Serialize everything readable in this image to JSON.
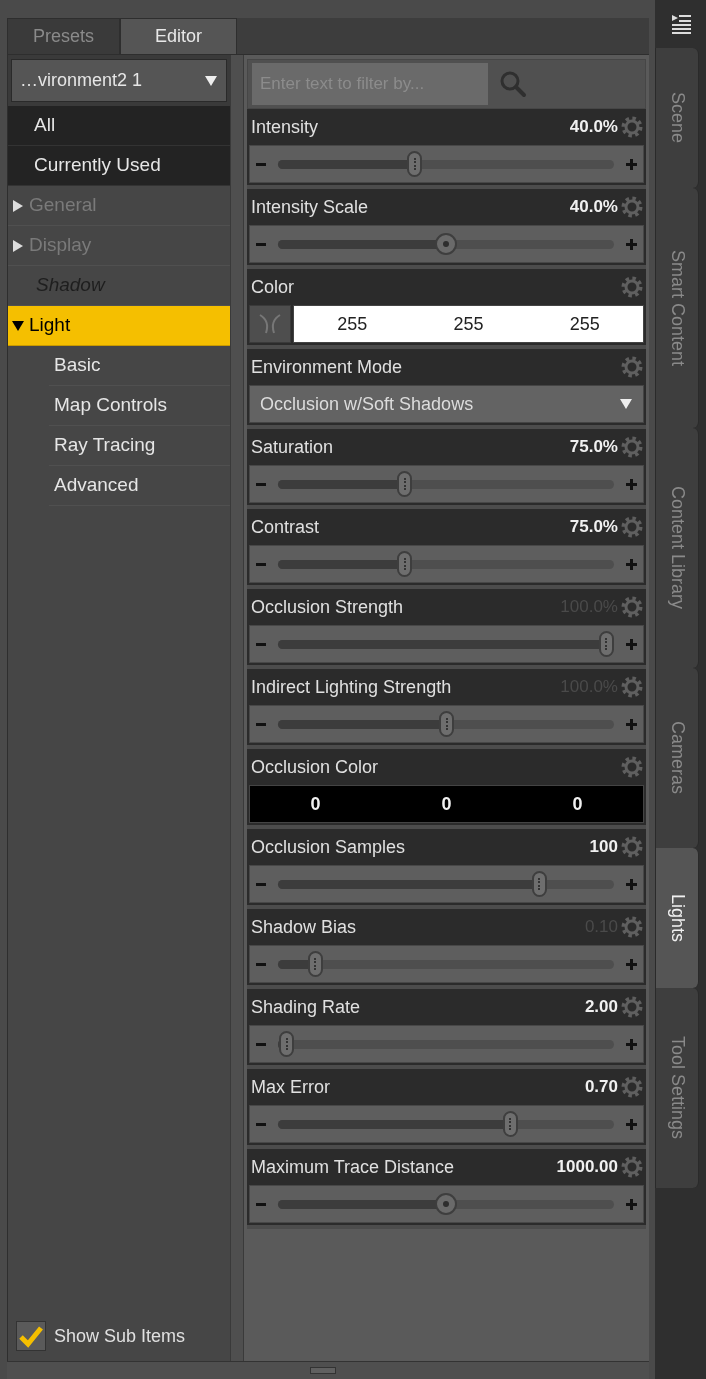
{
  "tabs": [
    {
      "label": "Presets",
      "selected": false
    },
    {
      "label": "Editor",
      "selected": true
    }
  ],
  "node_dropdown": {
    "value": "…vironment2 1"
  },
  "categories": [
    {
      "label": "All",
      "kind": "filter",
      "selected": false
    },
    {
      "label": "Currently Used",
      "kind": "filter",
      "selected": false
    },
    {
      "label": "General",
      "kind": "group",
      "expanded": false,
      "disabled": true,
      "selected": false
    },
    {
      "label": "Display",
      "kind": "group",
      "expanded": false,
      "disabled": true,
      "selected": false
    },
    {
      "label": "Shadow",
      "kind": "empty",
      "selected": false
    },
    {
      "label": "Light",
      "kind": "group",
      "expanded": true,
      "disabled": false,
      "selected": true,
      "children": [
        {
          "label": "Basic",
          "selected": false
        },
        {
          "label": "Map Controls",
          "selected": false
        },
        {
          "label": "Ray Tracing",
          "selected": false
        },
        {
          "label": "Advanced",
          "selected": false
        }
      ]
    }
  ],
  "show_sub_items": {
    "label": "Show Sub Items",
    "checked": true
  },
  "filter": {
    "placeholder": "Enter text to filter by..."
  },
  "parameters": [
    {
      "kind": "slider",
      "label": "Intensity",
      "value": "40.0%",
      "dimmed": false,
      "level": 0.4
    },
    {
      "kind": "dial_slider",
      "label": "Intensity Scale",
      "value": "40.0%",
      "dimmed": false,
      "level": 0.5
    },
    {
      "kind": "color",
      "label": "Color",
      "color": "#ffffff",
      "picker": true,
      "values": [
        "255",
        "255",
        "255"
      ]
    },
    {
      "kind": "dropdown",
      "label": "Environment Mode",
      "value": "Occlusion w/Soft Shadows"
    },
    {
      "kind": "slider",
      "label": "Saturation",
      "value": "75.0%",
      "dimmed": false,
      "level": 0.37
    },
    {
      "kind": "slider",
      "label": "Contrast",
      "value": "75.0%",
      "dimmed": false,
      "level": 0.37
    },
    {
      "kind": "slider",
      "label": "Occlusion Strength",
      "value": "100.0%",
      "dimmed": true,
      "level": 1
    },
    {
      "kind": "slider",
      "label": "Indirect Lighting Strength",
      "value": "100.0%",
      "dimmed": true,
      "level": 0.5
    },
    {
      "kind": "color",
      "label": "Occlusion Color",
      "color": "#000000",
      "picker": false,
      "values": [
        "0",
        "0",
        "0"
      ]
    },
    {
      "kind": "slider",
      "label": "Occlusion Samples",
      "value": "100",
      "dimmed": false,
      "level": 0.79
    },
    {
      "kind": "slider",
      "label": "Shadow Bias",
      "value": "0.10",
      "dimmed": true,
      "level": 0.09
    },
    {
      "kind": "slider",
      "label": "Shading Rate",
      "value": "2.00",
      "dimmed": false,
      "level": 0
    },
    {
      "kind": "slider",
      "label": "Max Error",
      "value": "0.70",
      "dimmed": false,
      "level": 0.7
    },
    {
      "kind": "dial_slider",
      "label": "Maximum Trace Distance",
      "value": "1000.00",
      "dimmed": false,
      "level": 0.5
    }
  ],
  "side_tabs": [
    {
      "label": "Scene",
      "selected": false
    },
    {
      "label": "Smart Content",
      "selected": false
    },
    {
      "label": "Content Library",
      "selected": false
    },
    {
      "label": "Cameras",
      "selected": false
    },
    {
      "label": "Lights",
      "selected": true
    },
    {
      "label": "Tool Settings",
      "selected": false
    }
  ]
}
